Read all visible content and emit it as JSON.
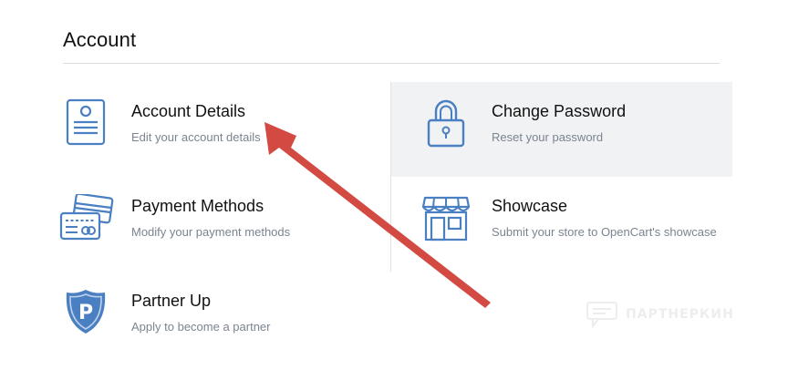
{
  "page": {
    "title": "Account"
  },
  "cards": {
    "account_details": {
      "title": "Account Details",
      "description": "Edit your account details",
      "icon": "id-card-icon"
    },
    "change_password": {
      "title": "Change Password",
      "description": "Reset your password",
      "icon": "padlock-icon"
    },
    "payment_methods": {
      "title": "Payment Methods",
      "description": "Modify your payment methods",
      "icon": "credit-cards-icon"
    },
    "showcase": {
      "title": "Showcase",
      "description": "Submit your store to OpenCart's showcase",
      "icon": "storefront-icon"
    },
    "partner_up": {
      "title": "Partner Up",
      "description": "Apply to become a partner",
      "icon": "partner-shield-icon"
    }
  },
  "watermark": {
    "text": "ПАРТНЕРКИН"
  },
  "colors": {
    "icon_blue": "#4a7fc1",
    "highlight_bg": "#f1f2f4",
    "annotation_arrow": "#d24a42"
  }
}
